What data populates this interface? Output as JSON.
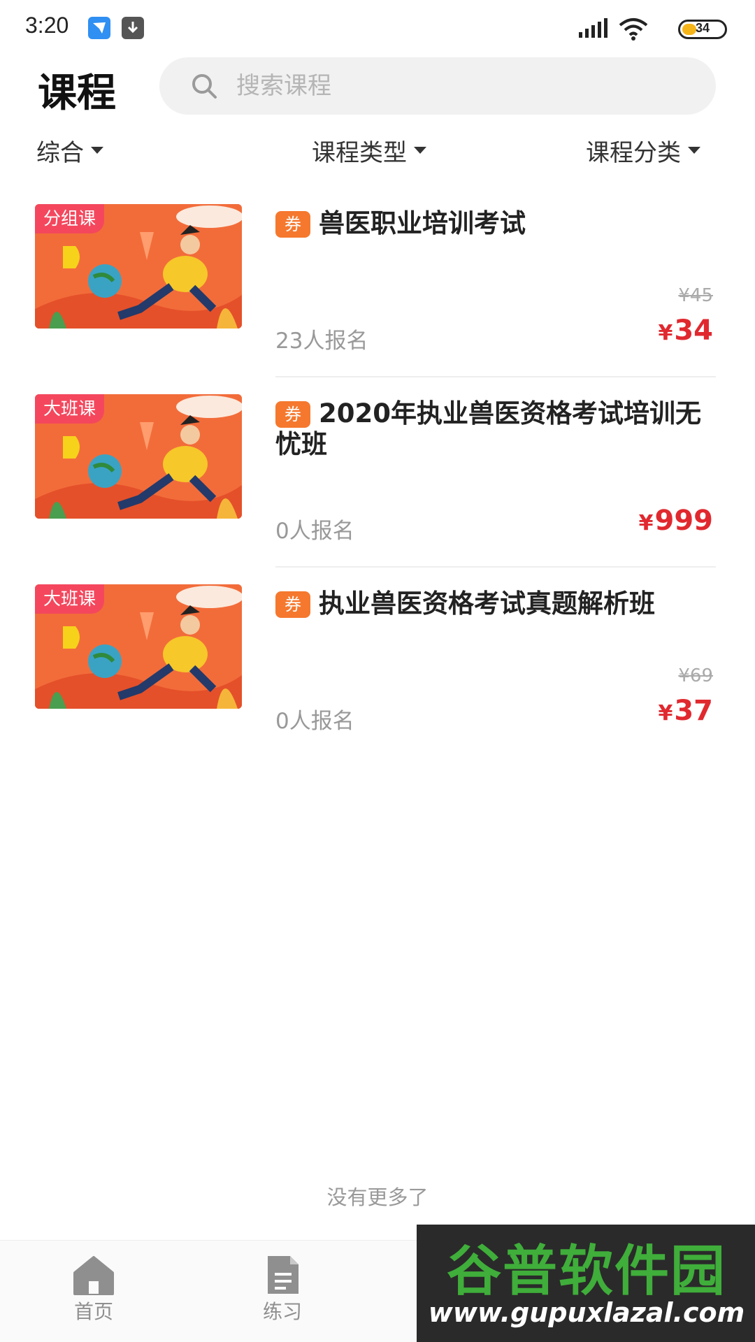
{
  "status_bar": {
    "time": "3:20",
    "battery": "34",
    "battery_level": 0.34
  },
  "header": {
    "title": "课程",
    "search_placeholder": "搜索课程"
  },
  "filters": [
    {
      "label": "综合"
    },
    {
      "label": "课程类型"
    },
    {
      "label": "课程分类"
    }
  ],
  "courses": [
    {
      "tag": "分组课",
      "coupon": "券",
      "title": "兽医职业培训考试",
      "original_price": "¥45",
      "enrolled": "23人报名",
      "price_symbol": "¥",
      "price": "34"
    },
    {
      "tag": "大班课",
      "coupon": "券",
      "title": "2020年执业兽医资格考试培训无忧班",
      "original_price": "",
      "enrolled": "0人报名",
      "price_symbol": "¥",
      "price": "999"
    },
    {
      "tag": "大班课",
      "coupon": "券",
      "title": "执业兽医资格考试真题解析班",
      "original_price": "¥69",
      "enrolled": "0人报名",
      "price_symbol": "¥",
      "price": "37"
    }
  ],
  "list_footer": "没有更多了",
  "tab_bar": [
    {
      "label": "首页",
      "icon": "home-icon"
    },
    {
      "label": "练习",
      "icon": "document-icon"
    },
    {
      "label": "",
      "icon": "course-icon"
    },
    {
      "label": "",
      "icon": "profile-icon"
    }
  ],
  "watermark": {
    "title": "谷普软件园",
    "url": "www.gupuxlazal.com"
  },
  "colors": {
    "accent_red": "#e0292f",
    "coupon_orange": "#f5782e",
    "tag_pink": "#f4475d",
    "thumb_orange": "#f26c3a"
  }
}
